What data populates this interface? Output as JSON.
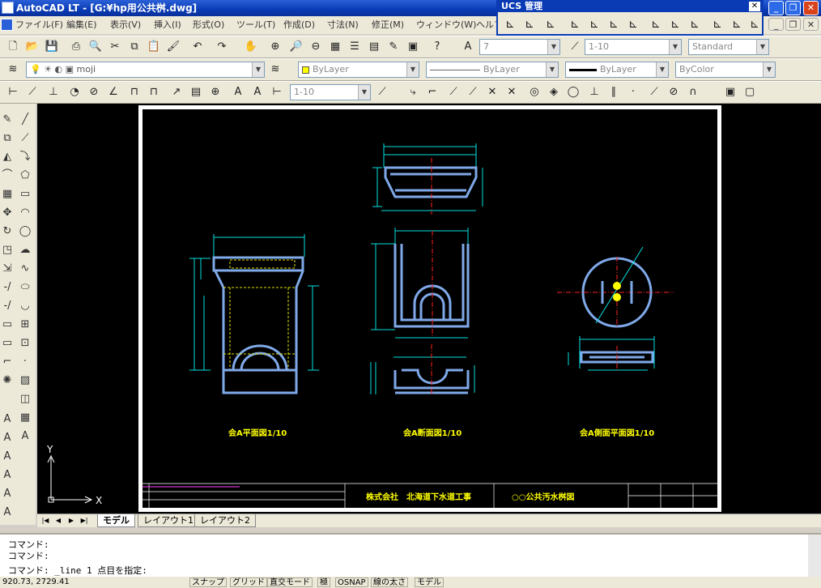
{
  "window": {
    "title": "AutoCAD LT - [G:¥hp用公共桝.dwg]"
  },
  "menu": [
    "ファイル(F)",
    "編集(E)",
    "表示(V)",
    "挿入(I)",
    "形式(O)",
    "ツール(T)",
    "作成(D)",
    "寸法(N)",
    "修正(M)",
    "ウィンドウ(W)",
    "ヘルプ"
  ],
  "ucs_panel": {
    "title": "UCS 管理"
  },
  "toolbar1": {
    "textstyle_value": "7",
    "dimscale_value": "1-10",
    "dimstyle_value": "Standard"
  },
  "toolbar2": {
    "layer_value": "moji",
    "color_value": "ByLayer",
    "linetype_value": "ByLayer",
    "lineweight_value": "ByLayer",
    "plotstyle_value": "ByColor"
  },
  "toolbar3": {
    "dimscale_value": "1-10"
  },
  "drawing": {
    "view_titles": [
      "会A平面図1/10",
      "会A断面図1/10",
      "会A側面平面図1/10"
    ],
    "title_block": {
      "company": "株式会社　北海道下水道工事",
      "drawing_name": "○○公共汚水桝図"
    }
  },
  "ucs_icon": {
    "x_label": "X",
    "y_label": "Y"
  },
  "layout_tabs": [
    "モデル",
    "レイアウト1",
    "レイアウト2"
  ],
  "command_lines": [
    "コマンド:",
    "コマンド:",
    "コマンド: _line 1 点目を指定:"
  ],
  "status": {
    "coords": "920.73, 2729.41",
    "buttons": [
      "スナップ",
      "グリッド",
      "直交モード",
      "極",
      "OSNAP",
      "線の太さ",
      "モデル"
    ]
  },
  "colors": {
    "title_bar": "#0a3bb5",
    "canvas": "#000000",
    "geometry": "#7fa9e8",
    "dimension": "#00e0e0",
    "center_line": "#ff2020",
    "text": "#ffff00"
  }
}
